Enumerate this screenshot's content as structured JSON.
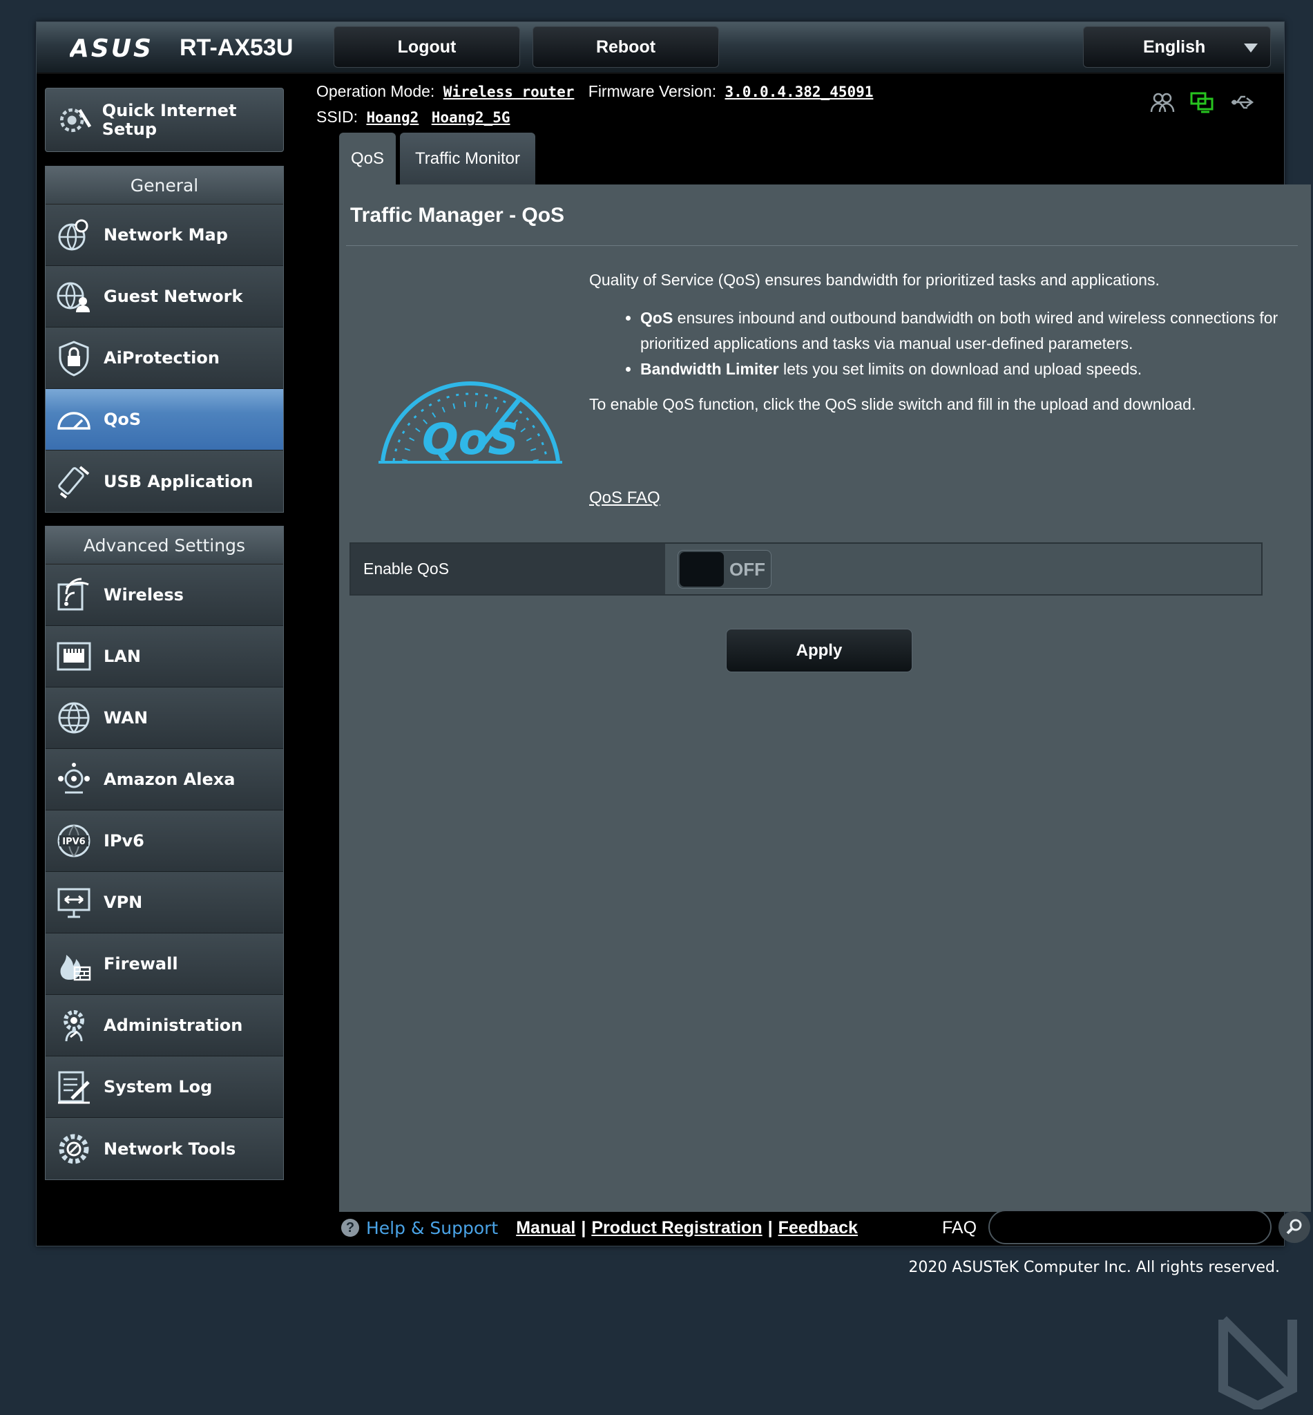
{
  "header": {
    "brand": "/ISUS",
    "model": "RT-AX53U",
    "logout_label": "Logout",
    "reboot_label": "Reboot",
    "language": "English"
  },
  "info": {
    "op_mode_label": "Operation Mode:",
    "op_mode_value": "Wireless router",
    "fw_label": "Firmware Version:",
    "fw_value": "3.0.0.4.382_45091",
    "ssid_label": "SSID:",
    "ssid_1": "Hoang2",
    "ssid_2": "Hoang2_5G"
  },
  "sidebar": {
    "quick_setup": "Quick Internet Setup",
    "general_title": "General",
    "general_items": [
      {
        "label": "Network Map",
        "icon": "globe-pin-icon"
      },
      {
        "label": "Guest Network",
        "icon": "guest-globe-icon"
      },
      {
        "label": "AiProtection",
        "icon": "lock-shield-icon"
      },
      {
        "label": "QoS",
        "icon": "gauge-icon",
        "active": true
      },
      {
        "label": "USB Application",
        "icon": "usb-icon"
      }
    ],
    "advanced_title": "Advanced Settings",
    "advanced_items": [
      {
        "label": "Wireless",
        "icon": "wireless-icon"
      },
      {
        "label": "LAN",
        "icon": "lan-port-icon"
      },
      {
        "label": "WAN",
        "icon": "globe-icon"
      },
      {
        "label": "Amazon Alexa",
        "icon": "alexa-icon"
      },
      {
        "label": "IPv6",
        "icon": "ipv6-icon"
      },
      {
        "label": "VPN",
        "icon": "vpn-monitor-icon"
      },
      {
        "label": "Firewall",
        "icon": "firewall-icon"
      },
      {
        "label": "Administration",
        "icon": "admin-gear-icon"
      },
      {
        "label": "System Log",
        "icon": "system-log-icon"
      },
      {
        "label": "Network Tools",
        "icon": "network-tools-icon"
      }
    ]
  },
  "tabs": [
    "QoS",
    "Traffic Monitor"
  ],
  "main": {
    "title": "Traffic Manager - QoS",
    "intro": "Quality of Service (QoS) ensures bandwidth for prioritized tasks and applications.",
    "bullet1_bold": "QoS",
    "bullet1_text": " ensures inbound and outbound bandwidth on both wired and wireless connections for prioritized applications and tasks via manual user-defined parameters.",
    "bullet2_bold": "Bandwidth Limiter",
    "bullet2_text": " lets you set limits on download and upload speeds.",
    "enable_hint": "To enable QoS function, click the QoS slide switch and fill in the upload and download.",
    "faq_link": "QoS FAQ",
    "gauge_text": "QoS",
    "enable_label": "Enable QoS",
    "switch_state": "OFF",
    "apply_label": "Apply"
  },
  "footer": {
    "help": "Help & Support",
    "manual": "Manual",
    "registration": "Product Registration",
    "feedback": "Feedback",
    "faq_label": "FAQ",
    "search_value": "",
    "copyright": "2020 ASUSTeK Computer Inc. All rights reserved."
  },
  "colors": {
    "active_menu": "#4d82bd",
    "content_bg": "#4d595f",
    "help_link": "#4aa3e6",
    "gauge_accent": "#2fb7e8"
  }
}
